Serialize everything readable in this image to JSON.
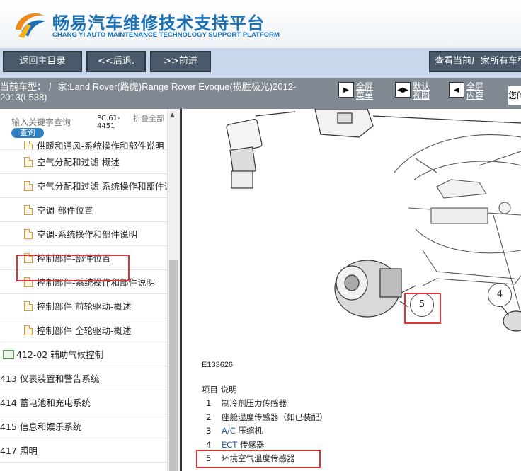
{
  "header": {
    "title": "畅易汽车维修技术支持平台",
    "subtitle": "CHANG YI AUTO MAINTENANCE TECHNOLOGY SUPPORT PLATFORM",
    "brand_color": "#1b6fb3"
  },
  "toolbar": {
    "home_label": "返回主目录",
    "back_label": "<<后退.",
    "forward_label": ">>前进",
    "all_models_label": "查看当前厂家所有车型"
  },
  "infobar": {
    "vehicle_text": "当前车型：  厂家:Land Rover(路虎)Range Rover Evoque(揽胜极光)2012-2013(L538)",
    "fullscreen_menu_label": "全屏菜单",
    "default_view_label": "默认视图",
    "fullscreen_content_label": "全屏内容",
    "clipped_text": "您的"
  },
  "sidebar": {
    "search_placeholder": "输入关键字查询",
    "search_button": "查询",
    "pc_code": "PC.61-4451",
    "collapse_label": "折叠全部",
    "items": [
      {
        "label": "供暖和通风-系统操作和部件说明",
        "kind": "leaf"
      },
      {
        "label": "空气分配和过滤-概述",
        "kind": "leaf"
      },
      {
        "label": "空气分配和过滤-系统操作和部件说明",
        "kind": "leaf"
      },
      {
        "label": "空调-部件位置",
        "kind": "leaf"
      },
      {
        "label": "空调-系统操作和部件说明",
        "kind": "leaf"
      },
      {
        "label": "控制部件-部件位置",
        "kind": "leaf",
        "selected": true
      },
      {
        "label": "控制部件-系统操作和部件说明",
        "kind": "leaf"
      },
      {
        "label": "控制部件 前轮驱动-概述",
        "kind": "leaf"
      },
      {
        "label": "控制部件 全轮驱动-概述",
        "kind": "leaf"
      },
      {
        "label": "412-02 辅助气候控制",
        "kind": "folder"
      },
      {
        "label": "413 仪表装置和警告系统",
        "kind": "top"
      },
      {
        "label": "414 蓄电池和充电系统",
        "kind": "top"
      },
      {
        "label": "415 信息和娱乐系统",
        "kind": "top"
      },
      {
        "label": "417 照明",
        "kind": "top"
      }
    ]
  },
  "diagram": {
    "figure_id": "E133626",
    "callouts": [
      "5",
      "4"
    ],
    "legend_header": "项目  说明",
    "legend": [
      {
        "num": "1",
        "prefix": "",
        "text": "制冷剂压力传感器"
      },
      {
        "num": "2",
        "prefix": "",
        "text": "座舱湿度传感器（如已装配）"
      },
      {
        "num": "3",
        "prefix": "A/C",
        "text": " 压缩机"
      },
      {
        "num": "4",
        "prefix": "ECT",
        "text": " 传感器"
      },
      {
        "num": "5",
        "prefix": "",
        "text": "环境空气温度传感器"
      }
    ],
    "highlight_color": "#d8343a"
  }
}
